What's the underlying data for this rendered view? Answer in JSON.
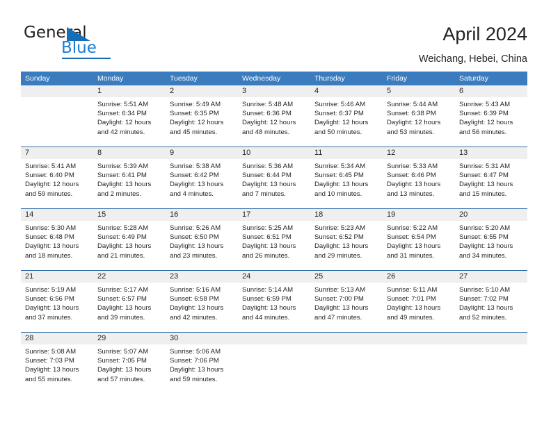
{
  "brand": {
    "name_part1": "General",
    "name_part2": "Blue",
    "triangle_icon": "triangle-icon"
  },
  "header": {
    "title": "April 2024",
    "location": "Weichang, Hebei, China"
  },
  "calendar": {
    "weekdays": [
      "Sunday",
      "Monday",
      "Tuesday",
      "Wednesday",
      "Thursday",
      "Friday",
      "Saturday"
    ],
    "accent_color": "#3b7cbe",
    "band_color": "#efefef",
    "weeks": [
      [
        {
          "day": "",
          "sunrise": "",
          "sunset": "",
          "daylight_line1": "",
          "daylight_line2": ""
        },
        {
          "day": "1",
          "sunrise": "Sunrise: 5:51 AM",
          "sunset": "Sunset: 6:34 PM",
          "daylight_line1": "Daylight: 12 hours",
          "daylight_line2": "and 42 minutes."
        },
        {
          "day": "2",
          "sunrise": "Sunrise: 5:49 AM",
          "sunset": "Sunset: 6:35 PM",
          "daylight_line1": "Daylight: 12 hours",
          "daylight_line2": "and 45 minutes."
        },
        {
          "day": "3",
          "sunrise": "Sunrise: 5:48 AM",
          "sunset": "Sunset: 6:36 PM",
          "daylight_line1": "Daylight: 12 hours",
          "daylight_line2": "and 48 minutes."
        },
        {
          "day": "4",
          "sunrise": "Sunrise: 5:46 AM",
          "sunset": "Sunset: 6:37 PM",
          "daylight_line1": "Daylight: 12 hours",
          "daylight_line2": "and 50 minutes."
        },
        {
          "day": "5",
          "sunrise": "Sunrise: 5:44 AM",
          "sunset": "Sunset: 6:38 PM",
          "daylight_line1": "Daylight: 12 hours",
          "daylight_line2": "and 53 minutes."
        },
        {
          "day": "6",
          "sunrise": "Sunrise: 5:43 AM",
          "sunset": "Sunset: 6:39 PM",
          "daylight_line1": "Daylight: 12 hours",
          "daylight_line2": "and 56 minutes."
        }
      ],
      [
        {
          "day": "7",
          "sunrise": "Sunrise: 5:41 AM",
          "sunset": "Sunset: 6:40 PM",
          "daylight_line1": "Daylight: 12 hours",
          "daylight_line2": "and 59 minutes."
        },
        {
          "day": "8",
          "sunrise": "Sunrise: 5:39 AM",
          "sunset": "Sunset: 6:41 PM",
          "daylight_line1": "Daylight: 13 hours",
          "daylight_line2": "and 2 minutes."
        },
        {
          "day": "9",
          "sunrise": "Sunrise: 5:38 AM",
          "sunset": "Sunset: 6:42 PM",
          "daylight_line1": "Daylight: 13 hours",
          "daylight_line2": "and 4 minutes."
        },
        {
          "day": "10",
          "sunrise": "Sunrise: 5:36 AM",
          "sunset": "Sunset: 6:44 PM",
          "daylight_line1": "Daylight: 13 hours",
          "daylight_line2": "and 7 minutes."
        },
        {
          "day": "11",
          "sunrise": "Sunrise: 5:34 AM",
          "sunset": "Sunset: 6:45 PM",
          "daylight_line1": "Daylight: 13 hours",
          "daylight_line2": "and 10 minutes."
        },
        {
          "day": "12",
          "sunrise": "Sunrise: 5:33 AM",
          "sunset": "Sunset: 6:46 PM",
          "daylight_line1": "Daylight: 13 hours",
          "daylight_line2": "and 13 minutes."
        },
        {
          "day": "13",
          "sunrise": "Sunrise: 5:31 AM",
          "sunset": "Sunset: 6:47 PM",
          "daylight_line1": "Daylight: 13 hours",
          "daylight_line2": "and 15 minutes."
        }
      ],
      [
        {
          "day": "14",
          "sunrise": "Sunrise: 5:30 AM",
          "sunset": "Sunset: 6:48 PM",
          "daylight_line1": "Daylight: 13 hours",
          "daylight_line2": "and 18 minutes."
        },
        {
          "day": "15",
          "sunrise": "Sunrise: 5:28 AM",
          "sunset": "Sunset: 6:49 PM",
          "daylight_line1": "Daylight: 13 hours",
          "daylight_line2": "and 21 minutes."
        },
        {
          "day": "16",
          "sunrise": "Sunrise: 5:26 AM",
          "sunset": "Sunset: 6:50 PM",
          "daylight_line1": "Daylight: 13 hours",
          "daylight_line2": "and 23 minutes."
        },
        {
          "day": "17",
          "sunrise": "Sunrise: 5:25 AM",
          "sunset": "Sunset: 6:51 PM",
          "daylight_line1": "Daylight: 13 hours",
          "daylight_line2": "and 26 minutes."
        },
        {
          "day": "18",
          "sunrise": "Sunrise: 5:23 AM",
          "sunset": "Sunset: 6:52 PM",
          "daylight_line1": "Daylight: 13 hours",
          "daylight_line2": "and 29 minutes."
        },
        {
          "day": "19",
          "sunrise": "Sunrise: 5:22 AM",
          "sunset": "Sunset: 6:54 PM",
          "daylight_line1": "Daylight: 13 hours",
          "daylight_line2": "and 31 minutes."
        },
        {
          "day": "20",
          "sunrise": "Sunrise: 5:20 AM",
          "sunset": "Sunset: 6:55 PM",
          "daylight_line1": "Daylight: 13 hours",
          "daylight_line2": "and 34 minutes."
        }
      ],
      [
        {
          "day": "21",
          "sunrise": "Sunrise: 5:19 AM",
          "sunset": "Sunset: 6:56 PM",
          "daylight_line1": "Daylight: 13 hours",
          "daylight_line2": "and 37 minutes."
        },
        {
          "day": "22",
          "sunrise": "Sunrise: 5:17 AM",
          "sunset": "Sunset: 6:57 PM",
          "daylight_line1": "Daylight: 13 hours",
          "daylight_line2": "and 39 minutes."
        },
        {
          "day": "23",
          "sunrise": "Sunrise: 5:16 AM",
          "sunset": "Sunset: 6:58 PM",
          "daylight_line1": "Daylight: 13 hours",
          "daylight_line2": "and 42 minutes."
        },
        {
          "day": "24",
          "sunrise": "Sunrise: 5:14 AM",
          "sunset": "Sunset: 6:59 PM",
          "daylight_line1": "Daylight: 13 hours",
          "daylight_line2": "and 44 minutes."
        },
        {
          "day": "25",
          "sunrise": "Sunrise: 5:13 AM",
          "sunset": "Sunset: 7:00 PM",
          "daylight_line1": "Daylight: 13 hours",
          "daylight_line2": "and 47 minutes."
        },
        {
          "day": "26",
          "sunrise": "Sunrise: 5:11 AM",
          "sunset": "Sunset: 7:01 PM",
          "daylight_line1": "Daylight: 13 hours",
          "daylight_line2": "and 49 minutes."
        },
        {
          "day": "27",
          "sunrise": "Sunrise: 5:10 AM",
          "sunset": "Sunset: 7:02 PM",
          "daylight_line1": "Daylight: 13 hours",
          "daylight_line2": "and 52 minutes."
        }
      ],
      [
        {
          "day": "28",
          "sunrise": "Sunrise: 5:08 AM",
          "sunset": "Sunset: 7:03 PM",
          "daylight_line1": "Daylight: 13 hours",
          "daylight_line2": "and 55 minutes."
        },
        {
          "day": "29",
          "sunrise": "Sunrise: 5:07 AM",
          "sunset": "Sunset: 7:05 PM",
          "daylight_line1": "Daylight: 13 hours",
          "daylight_line2": "and 57 minutes."
        },
        {
          "day": "30",
          "sunrise": "Sunrise: 5:06 AM",
          "sunset": "Sunset: 7:06 PM",
          "daylight_line1": "Daylight: 13 hours",
          "daylight_line2": "and 59 minutes."
        },
        {
          "day": "",
          "sunrise": "",
          "sunset": "",
          "daylight_line1": "",
          "daylight_line2": ""
        },
        {
          "day": "",
          "sunrise": "",
          "sunset": "",
          "daylight_line1": "",
          "daylight_line2": ""
        },
        {
          "day": "",
          "sunrise": "",
          "sunset": "",
          "daylight_line1": "",
          "daylight_line2": ""
        },
        {
          "day": "",
          "sunrise": "",
          "sunset": "",
          "daylight_line1": "",
          "daylight_line2": ""
        }
      ]
    ]
  }
}
